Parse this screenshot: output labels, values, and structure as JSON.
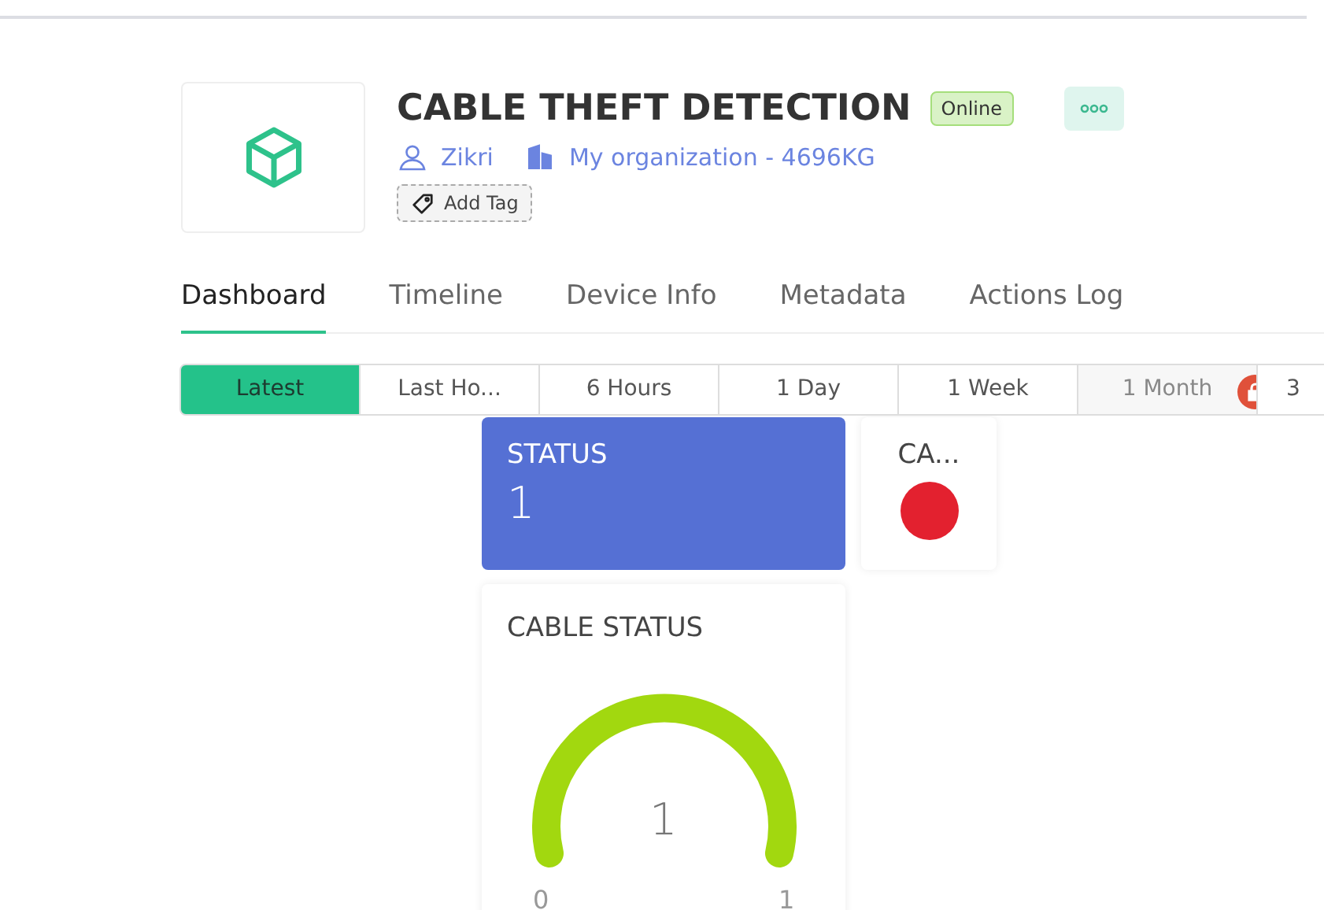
{
  "device": {
    "title": "CABLE THEFT DETECTION",
    "status": "Online",
    "owner": "Zikri",
    "organization": "My organization - 4696KG",
    "add_tag": "Add Tag"
  },
  "tabs": [
    {
      "label": "Dashboard",
      "selected": true
    },
    {
      "label": "Timeline",
      "selected": false
    },
    {
      "label": "Device Info",
      "selected": false
    },
    {
      "label": "Metadata",
      "selected": false
    },
    {
      "label": "Actions Log",
      "selected": false
    }
  ],
  "time_ranges": [
    {
      "label": "Latest",
      "selected": true,
      "locked": false
    },
    {
      "label": "Last Ho...",
      "selected": false,
      "locked": false
    },
    {
      "label": "6 Hours",
      "selected": false,
      "locked": false
    },
    {
      "label": "1 Day",
      "selected": false,
      "locked": false
    },
    {
      "label": "1 Week",
      "selected": false,
      "locked": false
    },
    {
      "label": "1 Month",
      "selected": false,
      "locked": true
    },
    {
      "label": "3",
      "selected": false,
      "locked": false
    }
  ],
  "widgets": [
    {
      "kind": "value",
      "title": "STATUS",
      "value": "1"
    },
    {
      "kind": "led",
      "title": "CA...",
      "color": "#e3212f"
    },
    {
      "kind": "gauge",
      "title": "CABLE STATUS",
      "value": "1",
      "min": "0",
      "max": "1"
    }
  ]
}
